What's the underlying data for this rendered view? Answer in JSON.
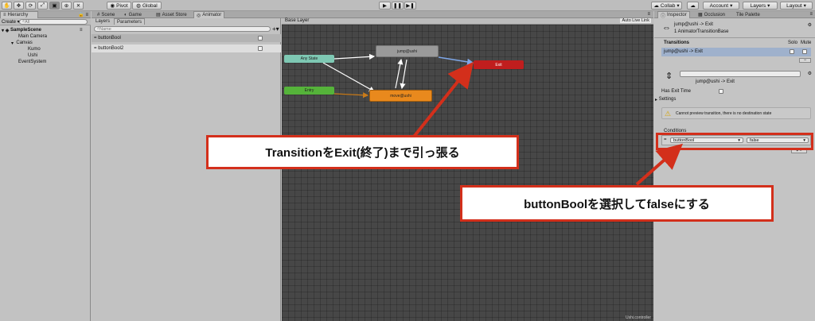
{
  "toolbar": {
    "pivot": "Pivot",
    "global": "Global",
    "collab": "Collab",
    "account": "Account",
    "layers": "Layers",
    "layout": "Layout"
  },
  "hierarchy": {
    "tab": "Hierarchy",
    "create": "Create",
    "search_placeholder": "All",
    "scene": "SampleScene",
    "items": [
      {
        "label": "Main Camera"
      },
      {
        "label": "Canvas"
      },
      {
        "label": "Kumo"
      },
      {
        "label": "Ushi"
      },
      {
        "label": "EventSystem"
      }
    ]
  },
  "center_tabs": {
    "scene": "Scene",
    "game": "Game",
    "asset_store": "Asset Store",
    "animator": "Animator"
  },
  "animator": {
    "layers_tab": "Layers",
    "parameters_tab": "Parameters",
    "search_placeholder": "Name",
    "parameters": [
      {
        "name": "buttonBool"
      },
      {
        "name": "buttonBool2"
      }
    ],
    "breadcrumb": "Base Layer",
    "auto_live_link": "Auto Live Link",
    "footer": "Ushi.controller",
    "nodes": {
      "any_state": "Any State",
      "entry": "Entry",
      "jump": "jump@ushi",
      "move": "move@ushi",
      "exit": "Exit"
    },
    "colors": {
      "any_state": "#7ec8b3",
      "entry": "#55b33a",
      "state": "#9a9a9a",
      "default_state": "#e9891d",
      "exit": "#c01e1e"
    }
  },
  "inspector": {
    "tab_inspector": "Inspector",
    "tab_occlusion": "Occlusion",
    "tab_tile_palette": "Tile Palette",
    "title": "jump@ushi -> Exit",
    "subtitle": "1 AnimatorTransitionBase",
    "transitions_header": "Transitions",
    "solo": "Solo",
    "mute": "Mute",
    "transition_row": "jump@ushi -> Exit",
    "transition_name": "jump@ushi -> Exit",
    "has_exit_time": "Has Exit Time",
    "settings": "Settings",
    "warning": "Cannot preview transition, there is no destination state",
    "conditions_header": "Conditions",
    "condition_param": "buttonBool",
    "condition_value": "false"
  },
  "annotations": {
    "callout1": "TransitionをExit(終了)まで引っ張る",
    "callout2": "buttonBoolを選択してfalseにする",
    "arrow_color": "#d32f1b"
  }
}
